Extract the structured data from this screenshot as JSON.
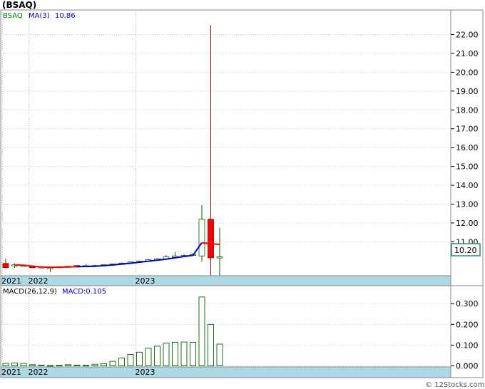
{
  "chart_data": [
    {
      "type": "candlestick",
      "title": "(BSAQ)",
      "legend": [
        {
          "label": "BSAQ",
          "color": "#008000"
        },
        {
          "label": "MA(3)",
          "color": "#0000cc"
        },
        {
          "label": "10.86",
          "color": "#0000cc"
        }
      ],
      "last_price_label": "10.20",
      "ylim": [
        9.2,
        22.7
      ],
      "yticks": [
        11,
        12,
        13,
        14,
        15,
        16,
        17,
        18,
        19,
        20,
        21,
        22
      ],
      "ytick_labels": [
        "11.00",
        "12.00",
        "13.00",
        "14.00",
        "15.00",
        "16.00",
        "17.00",
        "18.00",
        "19.00",
        "20.00",
        "21.00",
        "22.00"
      ],
      "x_labels": [
        {
          "text": "2021",
          "index": 0
        },
        {
          "text": "2022",
          "index": 3
        },
        {
          "text": "2023",
          "index": 15
        }
      ],
      "candles": [
        {
          "o": 9.85,
          "h": 10.1,
          "l": 9.6,
          "c": 9.63
        },
        {
          "o": 9.72,
          "h": 9.85,
          "l": 9.62,
          "c": 9.78
        },
        {
          "o": 9.73,
          "h": 9.8,
          "l": 9.68,
          "c": 9.75
        },
        {
          "o": 9.68,
          "h": 9.72,
          "l": 9.6,
          "c": 9.67
        },
        {
          "o": 9.65,
          "h": 9.7,
          "l": 9.62,
          "c": 9.67
        },
        {
          "o": 9.62,
          "h": 9.68,
          "l": 9.4,
          "c": 9.64
        },
        {
          "o": 9.63,
          "h": 9.7,
          "l": 9.6,
          "c": 9.68
        },
        {
          "o": 9.66,
          "h": 9.72,
          "l": 9.64,
          "c": 9.7
        },
        {
          "o": 9.74,
          "h": 9.76,
          "l": 9.64,
          "c": 9.66
        },
        {
          "o": 9.68,
          "h": 9.82,
          "l": 9.65,
          "c": 9.73
        },
        {
          "o": 9.7,
          "h": 9.78,
          "l": 9.68,
          "c": 9.74
        },
        {
          "o": 9.72,
          "h": 9.8,
          "l": 9.7,
          "c": 9.78
        },
        {
          "o": 9.76,
          "h": 9.84,
          "l": 9.74,
          "c": 9.82
        },
        {
          "o": 9.8,
          "h": 9.9,
          "l": 9.78,
          "c": 9.87
        },
        {
          "o": 9.86,
          "h": 9.96,
          "l": 9.84,
          "c": 9.93
        },
        {
          "o": 9.91,
          "h": 10.0,
          "l": 9.88,
          "c": 9.97
        },
        {
          "o": 9.96,
          "h": 10.1,
          "l": 9.94,
          "c": 10.05
        },
        {
          "o": 10.02,
          "h": 10.14,
          "l": 10.0,
          "c": 10.1
        },
        {
          "o": 10.08,
          "h": 10.3,
          "l": 10.05,
          "c": 10.2
        },
        {
          "o": 10.18,
          "h": 10.45,
          "l": 10.15,
          "c": 10.25
        },
        {
          "o": 10.24,
          "h": 10.35,
          "l": 10.22,
          "c": 10.28
        },
        {
          "o": 10.28,
          "h": 10.38,
          "l": 10.26,
          "c": 10.33
        },
        {
          "o": 10.25,
          "h": 12.95,
          "l": 9.95,
          "c": 12.2
        },
        {
          "o": 12.2,
          "h": 22.5,
          "l": 9.2,
          "c": 10.15
        },
        {
          "o": 10.15,
          "h": 11.75,
          "l": 9.2,
          "c": 10.2
        }
      ],
      "ma": [
        {
          "index": 1,
          "value": 9.77
        },
        {
          "index": 2,
          "value": 9.76
        },
        {
          "index": 4,
          "value": 9.66
        },
        {
          "index": 6,
          "value": 9.65
        },
        {
          "index": 8,
          "value": 9.68
        },
        {
          "index": 10,
          "value": 9.7
        },
        {
          "index": 12,
          "value": 9.77
        },
        {
          "index": 14,
          "value": 9.86
        },
        {
          "index": 16,
          "value": 9.97
        },
        {
          "index": 18,
          "value": 10.08
        },
        {
          "index": 20,
          "value": 10.22
        },
        {
          "index": 21,
          "value": 10.28
        },
        {
          "index": 22,
          "value": 10.95
        },
        {
          "index": 23,
          "value": 10.9
        },
        {
          "index": 24,
          "value": 10.86
        }
      ]
    },
    {
      "type": "bar",
      "legend": [
        {
          "label": "MACD(26,12,9)",
          "color": "#000000"
        },
        {
          "label": "MACD:0.105",
          "color": "#0000cc"
        }
      ],
      "ylim": [
        -0.005,
        0.335
      ],
      "yticks": [
        0,
        0.1,
        0.2,
        0.3
      ],
      "ytick_labels": [
        "0.000",
        "0.100",
        "0.200",
        "0.300"
      ],
      "x_labels": [
        {
          "text": "2021",
          "index": 0
        },
        {
          "text": "2022",
          "index": 3
        },
        {
          "text": "2023",
          "index": 15
        }
      ],
      "values": [
        0.012,
        0.014,
        0.012,
        0.006,
        0.004,
        0.002,
        0.003,
        0.006,
        0.004,
        0.003,
        0.008,
        0.011,
        0.022,
        0.038,
        0.055,
        0.066,
        0.085,
        0.095,
        0.11,
        0.114,
        0.115,
        0.114,
        0.332,
        0.2,
        0.105
      ]
    }
  ],
  "watermark": "© 12Stocks.com"
}
